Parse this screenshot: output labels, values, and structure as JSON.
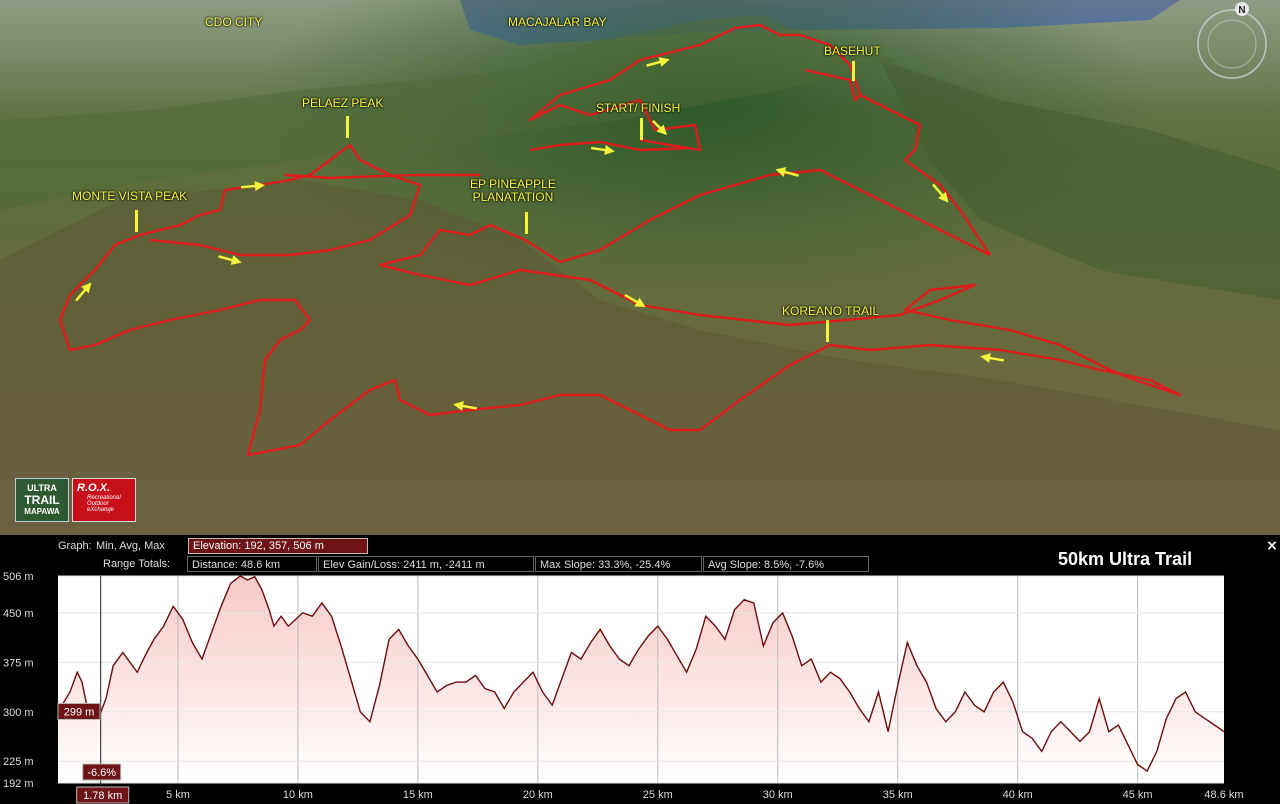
{
  "map": {
    "places": {
      "cdo_city": "CDO CITY",
      "macajalar_bay": "MACAJALAR BAY",
      "basehut": "BASEHUT",
      "pelaez_peak": "PELAEZ PEAK",
      "start_finish": "START/ FINISH",
      "monte_vista_peak": "MONTE VISTA PEAK",
      "ep_pineapple_1": "EP PINEAPPLE",
      "ep_pineapple_2": "PLANATATION",
      "koreano_trail": "KOREANO TRAIL"
    },
    "compass_letter": "N",
    "route_color": "#e01b1b",
    "arrow_color": "#f5f53a",
    "logos": {
      "ultra_trail": [
        "ULTRA",
        "TRAIL",
        "MAPAWA"
      ],
      "rox_title": "R.O.X.",
      "rox_subtitle": [
        "Recreational",
        "Outdoor",
        "eXchange"
      ]
    }
  },
  "elevation_panel": {
    "graph_label": "Graph:",
    "graph_mode": "Min, Avg, Max",
    "elevation_stats": "Elevation: 192, 357, 506 m",
    "range_totals_label": "Range Totals:",
    "distance": "Distance: 48.6 km",
    "elev_gain_loss": "Elev Gain/Loss: 2411 m, -2411 m",
    "max_slope": "Max Slope: 33.3%, -25.4%",
    "avg_slope": "Avg Slope: 8.5%, -7.6%",
    "title": "50km Ultra Trail",
    "close_icon": "×",
    "cursor_elevation": "299 m",
    "cursor_slope": "-6.6%",
    "cursor_distance": "1.78 km"
  },
  "chart_data": {
    "type": "area",
    "title": "50km Ultra Trail",
    "xlabel": "",
    "ylabel": "",
    "x_unit": "km",
    "y_unit": "m",
    "xlim": [
      0,
      48.6
    ],
    "ylim": [
      192,
      506
    ],
    "x_ticks": [
      "5 km",
      "10 km",
      "15 km",
      "20 km",
      "25 km",
      "30 km",
      "35 km",
      "40 km",
      "45 km",
      "48.6 km"
    ],
    "x_tick_values": [
      5,
      10,
      15,
      20,
      25,
      30,
      35,
      40,
      45,
      48.6
    ],
    "y_ticks": [
      "506 m",
      "450 m",
      "375 m",
      "300 m",
      "225 m",
      "192 m"
    ],
    "y_tick_values": [
      506,
      450,
      375,
      300,
      225,
      192
    ],
    "grid": true,
    "fill_color": "#f8c9c6",
    "line_color": "#6b0d0d",
    "cursor_x": 1.78,
    "series": [
      {
        "x": [
          0,
          0.5,
          0.8,
          1.0,
          1.2,
          1.5,
          1.78,
          2.0,
          2.3,
          2.7,
          3.0,
          3.3,
          3.7,
          4.0,
          4.4,
          4.8,
          5.2,
          5.6,
          6.0,
          6.4,
          6.8,
          7.2,
          7.6,
          7.9,
          8.2,
          8.5,
          8.8,
          9.0,
          9.3,
          9.6,
          9.9,
          10.2,
          10.6,
          11.0,
          11.4,
          11.8,
          12.2,
          12.6,
          13.0,
          13.4,
          13.8,
          14.2,
          14.6,
          15.0,
          15.4,
          15.8,
          16.2,
          16.6,
          17.0,
          17.4,
          17.8,
          18.2,
          18.6,
          19.0,
          19.4,
          19.8,
          20.2,
          20.6,
          21.0,
          21.4,
          21.8,
          22.2,
          22.6,
          23.0,
          23.4,
          23.8,
          24.2,
          24.6,
          25.0,
          25.4,
          25.8,
          26.2,
          26.6,
          27.0,
          27.4,
          27.8,
          28.2,
          28.6,
          29.0,
          29.4,
          29.8,
          30.2,
          30.6,
          31.0,
          31.4,
          31.8,
          32.2,
          32.6,
          33.0,
          33.4,
          33.8,
          34.2,
          34.6,
          35.0,
          35.4,
          35.8,
          36.2,
          36.6,
          37.0,
          37.4,
          37.8,
          38.2,
          38.6,
          39.0,
          39.4,
          39.8,
          40.2,
          40.6,
          41.0,
          41.4,
          41.8,
          42.2,
          42.6,
          43.0,
          43.4,
          43.8,
          44.2,
          44.6,
          45.0,
          45.4,
          45.8,
          46.2,
          46.6,
          47.0,
          47.4,
          47.8,
          48.2,
          48.6
        ],
        "y": [
          300,
          330,
          360,
          345,
          310,
          300,
          299,
          320,
          370,
          390,
          375,
          360,
          390,
          410,
          430,
          460,
          440,
          405,
          380,
          420,
          460,
          495,
          506,
          500,
          505,
          485,
          455,
          430,
          445,
          430,
          440,
          450,
          445,
          465,
          445,
          400,
          350,
          300,
          285,
          340,
          410,
          425,
          400,
          380,
          355,
          330,
          340,
          345,
          345,
          355,
          335,
          330,
          305,
          330,
          345,
          360,
          330,
          310,
          350,
          390,
          380,
          405,
          425,
          400,
          380,
          370,
          395,
          415,
          430,
          410,
          385,
          360,
          395,
          445,
          430,
          410,
          455,
          470,
          465,
          400,
          435,
          450,
          415,
          370,
          380,
          345,
          360,
          350,
          330,
          305,
          285,
          330,
          270,
          340,
          405,
          370,
          345,
          305,
          285,
          300,
          330,
          310,
          300,
          330,
          345,
          315,
          270,
          260,
          240,
          270,
          285,
          270,
          255,
          270,
          320,
          270,
          280,
          250,
          220,
          210,
          240,
          290,
          320,
          330,
          300,
          290,
          280,
          270
        ]
      }
    ]
  }
}
